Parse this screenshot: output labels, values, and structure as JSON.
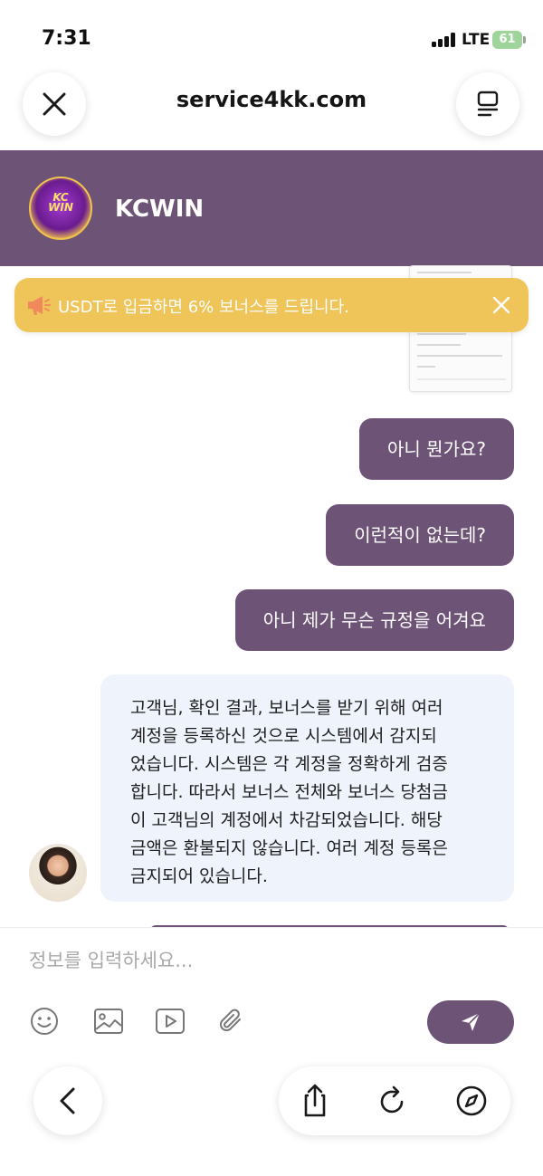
{
  "status_bar": {
    "time": "7:31",
    "network": "LTE",
    "battery": "61"
  },
  "browser": {
    "url": "service4kk.com",
    "close_icon": "close-icon",
    "menu_icon": "tabs-menu-icon"
  },
  "chat_header": {
    "brand_name": "KCWIN",
    "logo_text_top": "KC",
    "logo_text_bottom": "WIN"
  },
  "notice": {
    "text": "USDT로 입금하면 6% 보너스를 드립니다.",
    "icon": "megaphone-icon",
    "close_icon": "close-icon"
  },
  "messages": [
    {
      "from": "user",
      "text": "아니 뭔가요?"
    },
    {
      "from": "user",
      "text": "이런적이 없는데?"
    },
    {
      "from": "user",
      "text": "아니 제가 무슨 규정을 어겨요"
    },
    {
      "from": "agent",
      "lines": [
        "고객님, 확인 결과, 보너스를 받기 위해 여러",
        "계정을 등록하신 것으로 시스템에서 감지되",
        "었습니다. 시스템은 각 계정을 정확하게 검증",
        "합니다. 따라서 보너스 전체와 보너스 당첨금",
        "이 고객님의 계정에서 차감되었습니다. 해당",
        "금액은 환불되지 않습니다. 여러 계정 등록은",
        "금지되어 있습니다."
      ]
    }
  ],
  "input": {
    "placeholder": "정보를 입력하세요..."
  },
  "toolbar_icons": [
    "emoji-icon",
    "image-icon",
    "video-icon",
    "attachment-icon",
    "send-icon"
  ],
  "bottom_bar_icons": [
    "back-icon",
    "share-icon",
    "reload-icon",
    "compass-icon"
  ],
  "colors": {
    "brand": "#6d5476",
    "notice": "#efc459",
    "agent_bubble": "#eef3fc",
    "battery": "#9fd49b"
  }
}
